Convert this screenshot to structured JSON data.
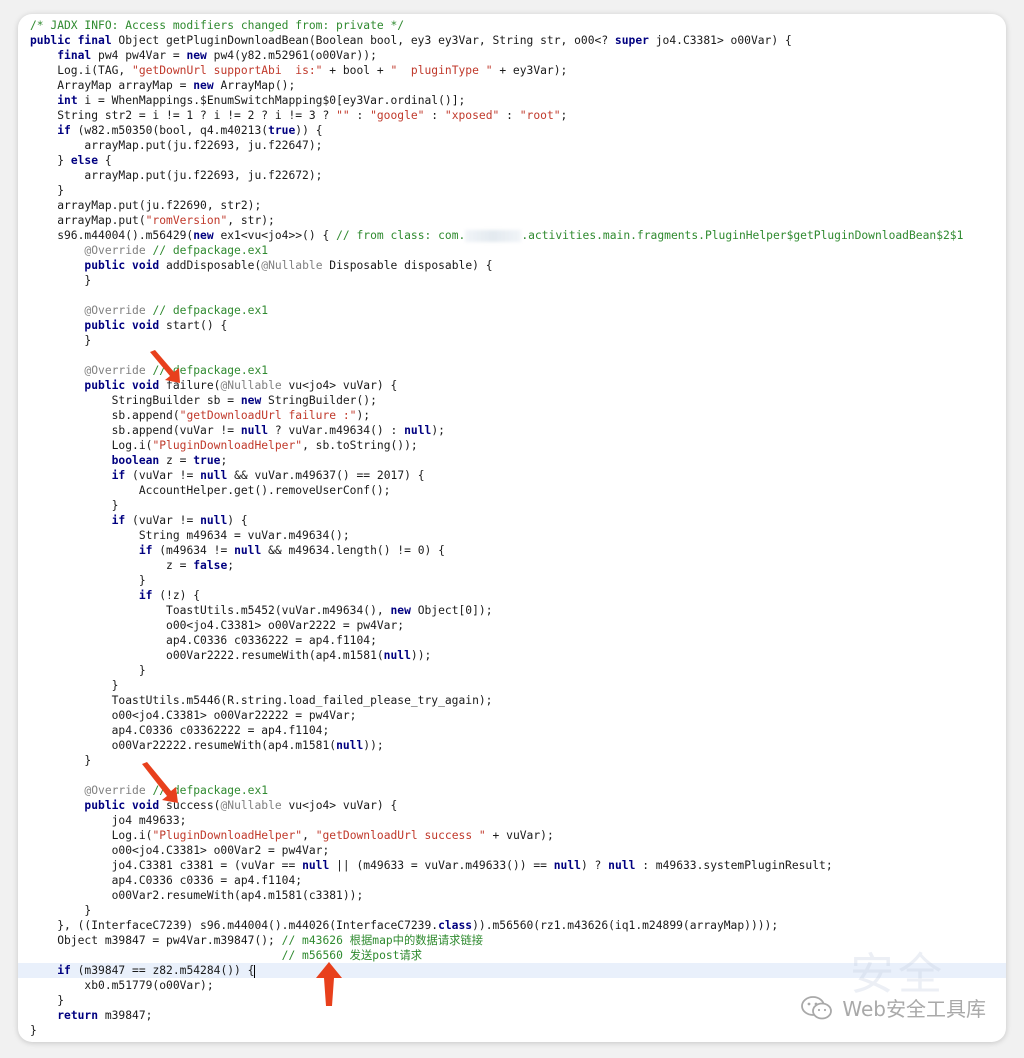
{
  "code_viewer": {
    "lines": [
      {
        "segs": [
          [
            "cm",
            "/* JADX INFO: Access modifiers changed from: private */"
          ]
        ]
      },
      {
        "segs": [
          [
            "kw",
            "public final "
          ],
          [
            "p",
            "Object getPluginDownloadBean(Boolean bool, ey3 ey3Var, String str, o00<? "
          ],
          [
            "kw",
            "super"
          ],
          [
            "p",
            " jo4.C3381> o00Var) {"
          ]
        ]
      },
      {
        "segs": [
          [
            "p",
            "    "
          ],
          [
            "kw",
            "final"
          ],
          [
            "p",
            " pw4 pw4Var = "
          ],
          [
            "kw",
            "new"
          ],
          [
            "p",
            " pw4(y82.m52961(o00Var));"
          ]
        ]
      },
      {
        "segs": [
          [
            "p",
            "    Log.i(TAG, "
          ],
          [
            "str",
            "\"getDownUrl supportAbi  is:\""
          ],
          [
            "p",
            " + bool + "
          ],
          [
            "str",
            "\"  pluginType \""
          ],
          [
            "p",
            " + ey3Var);"
          ]
        ]
      },
      {
        "segs": [
          [
            "p",
            "    ArrayMap arrayMap = "
          ],
          [
            "kw",
            "new"
          ],
          [
            "p",
            " ArrayMap();"
          ]
        ]
      },
      {
        "segs": [
          [
            "p",
            "    "
          ],
          [
            "kw",
            "int"
          ],
          [
            "p",
            " i = WhenMappings.$EnumSwitchMapping$0[ey3Var.ordinal()];"
          ]
        ]
      },
      {
        "segs": [
          [
            "p",
            "    String str2 = i != 1 ? i != 2 ? i != 3 ? "
          ],
          [
            "str",
            "\"\""
          ],
          [
            "p",
            " : "
          ],
          [
            "str",
            "\"google\""
          ],
          [
            "p",
            " : "
          ],
          [
            "str",
            "\"xposed\""
          ],
          [
            "p",
            " : "
          ],
          [
            "str",
            "\"root\""
          ],
          [
            "p",
            ";"
          ]
        ]
      },
      {
        "segs": [
          [
            "p",
            "    "
          ],
          [
            "kw",
            "if"
          ],
          [
            "p",
            " (w82.m50350(bool, q4.m40213("
          ],
          [
            "kw",
            "true"
          ],
          [
            "p",
            ")) {"
          ]
        ]
      },
      {
        "segs": [
          [
            "p",
            "        arrayMap.put(ju.f22693, ju.f22647);"
          ]
        ]
      },
      {
        "segs": [
          [
            "p",
            "    } "
          ],
          [
            "kw",
            "else"
          ],
          [
            "p",
            " {"
          ]
        ]
      },
      {
        "segs": [
          [
            "p",
            "        arrayMap.put(ju.f22693, ju.f22672);"
          ]
        ]
      },
      {
        "segs": [
          [
            "p",
            "    }"
          ]
        ]
      },
      {
        "segs": [
          [
            "p",
            "    arrayMap.put(ju.f22690, str2);"
          ]
        ]
      },
      {
        "segs": [
          [
            "p",
            "    arrayMap.put("
          ],
          [
            "str",
            "\"romVersion\""
          ],
          [
            "p",
            ", str);"
          ]
        ]
      },
      {
        "segs": [
          [
            "p",
            "    s96.m44004().m56429("
          ],
          [
            "kw",
            "new"
          ],
          [
            "p",
            " ex1<vu<jo4>>() { "
          ],
          [
            "cm",
            "// from class: com."
          ],
          [
            "blur",
            ""
          ],
          [
            "cm",
            ".activities.main.fragments.PluginHelper$getPluginDownloadBean$2$1"
          ]
        ]
      },
      {
        "segs": [
          [
            "p",
            "        "
          ],
          [
            "ann",
            "@Override"
          ],
          [
            "cm",
            " // defpackage.ex1"
          ]
        ]
      },
      {
        "segs": [
          [
            "p",
            "        "
          ],
          [
            "kw",
            "public void"
          ],
          [
            "p",
            " addDisposable("
          ],
          [
            "ann",
            "@Nullable"
          ],
          [
            "p",
            " Disposable disposable) {"
          ]
        ]
      },
      {
        "segs": [
          [
            "p",
            "        }"
          ]
        ]
      },
      {
        "segs": [
          [
            "p",
            ""
          ]
        ]
      },
      {
        "segs": [
          [
            "p",
            "        "
          ],
          [
            "ann",
            "@Override"
          ],
          [
            "cm",
            " // defpackage.ex1"
          ]
        ]
      },
      {
        "segs": [
          [
            "p",
            "        "
          ],
          [
            "kw",
            "public void"
          ],
          [
            "p",
            " start() {"
          ]
        ]
      },
      {
        "segs": [
          [
            "p",
            "        }"
          ]
        ]
      },
      {
        "segs": [
          [
            "p",
            ""
          ]
        ]
      },
      {
        "segs": [
          [
            "p",
            "        "
          ],
          [
            "ann",
            "@Override"
          ],
          [
            "cm",
            " // defpackage.ex1"
          ]
        ]
      },
      {
        "segs": [
          [
            "p",
            "        "
          ],
          [
            "kw",
            "public void"
          ],
          [
            "p",
            " failure("
          ],
          [
            "ann",
            "@Nullable"
          ],
          [
            "p",
            " vu<jo4> vuVar) {"
          ]
        ]
      },
      {
        "segs": [
          [
            "p",
            "            StringBuilder sb = "
          ],
          [
            "kw",
            "new"
          ],
          [
            "p",
            " StringBuilder();"
          ]
        ]
      },
      {
        "segs": [
          [
            "p",
            "            sb.append("
          ],
          [
            "str",
            "\"getDownloadUrl failure :\""
          ],
          [
            "p",
            ");"
          ]
        ]
      },
      {
        "segs": [
          [
            "p",
            "            sb.append(vuVar != "
          ],
          [
            "kw",
            "null"
          ],
          [
            "p",
            " ? vuVar.m49634() : "
          ],
          [
            "kw",
            "null"
          ],
          [
            "p",
            ");"
          ]
        ]
      },
      {
        "segs": [
          [
            "p",
            "            Log.i("
          ],
          [
            "str",
            "\"PluginDownloadHelper\""
          ],
          [
            "p",
            ", sb.toString());"
          ]
        ]
      },
      {
        "segs": [
          [
            "p",
            "            "
          ],
          [
            "kw",
            "boolean"
          ],
          [
            "p",
            " z = "
          ],
          [
            "kw",
            "true"
          ],
          [
            "p",
            ";"
          ]
        ]
      },
      {
        "segs": [
          [
            "p",
            "            "
          ],
          [
            "kw",
            "if"
          ],
          [
            "p",
            " (vuVar != "
          ],
          [
            "kw",
            "null"
          ],
          [
            "p",
            " && vuVar.m49637() == 2017) {"
          ]
        ]
      },
      {
        "segs": [
          [
            "p",
            "                AccountHelper.get().removeUserConf();"
          ]
        ]
      },
      {
        "segs": [
          [
            "p",
            "            }"
          ]
        ]
      },
      {
        "segs": [
          [
            "p",
            "            "
          ],
          [
            "kw",
            "if"
          ],
          [
            "p",
            " (vuVar != "
          ],
          [
            "kw",
            "null"
          ],
          [
            "p",
            ") {"
          ]
        ]
      },
      {
        "segs": [
          [
            "p",
            "                String m49634 = vuVar.m49634();"
          ]
        ]
      },
      {
        "segs": [
          [
            "p",
            "                "
          ],
          [
            "kw",
            "if"
          ],
          [
            "p",
            " (m49634 != "
          ],
          [
            "kw",
            "null"
          ],
          [
            "p",
            " && m49634.length() != 0) {"
          ]
        ]
      },
      {
        "segs": [
          [
            "p",
            "                    z = "
          ],
          [
            "kw",
            "false"
          ],
          [
            "p",
            ";"
          ]
        ]
      },
      {
        "segs": [
          [
            "p",
            "                }"
          ]
        ]
      },
      {
        "segs": [
          [
            "p",
            "                "
          ],
          [
            "kw",
            "if"
          ],
          [
            "p",
            " (!z) {"
          ]
        ]
      },
      {
        "segs": [
          [
            "p",
            "                    ToastUtils.m5452(vuVar.m49634(), "
          ],
          [
            "kw",
            "new"
          ],
          [
            "p",
            " Object[0]);"
          ]
        ]
      },
      {
        "segs": [
          [
            "p",
            "                    o00<jo4.C3381> o00Var2222 = pw4Var;"
          ]
        ]
      },
      {
        "segs": [
          [
            "p",
            "                    ap4.C0336 c0336222 = ap4.f1104;"
          ]
        ]
      },
      {
        "segs": [
          [
            "p",
            "                    o00Var2222.resumeWith(ap4.m1581("
          ],
          [
            "kw",
            "null"
          ],
          [
            "p",
            "));"
          ]
        ]
      },
      {
        "segs": [
          [
            "p",
            "                }"
          ]
        ]
      },
      {
        "segs": [
          [
            "p",
            "            }"
          ]
        ]
      },
      {
        "segs": [
          [
            "p",
            "            ToastUtils.m5446(R.string.load_failed_please_try_again);"
          ]
        ]
      },
      {
        "segs": [
          [
            "p",
            "            o00<jo4.C3381> o00Var22222 = pw4Var;"
          ]
        ]
      },
      {
        "segs": [
          [
            "p",
            "            ap4.C0336 c03362222 = ap4.f1104;"
          ]
        ]
      },
      {
        "segs": [
          [
            "p",
            "            o00Var22222.resumeWith(ap4.m1581("
          ],
          [
            "kw",
            "null"
          ],
          [
            "p",
            "));"
          ]
        ]
      },
      {
        "segs": [
          [
            "p",
            "        }"
          ]
        ]
      },
      {
        "segs": [
          [
            "p",
            ""
          ]
        ]
      },
      {
        "segs": [
          [
            "p",
            "        "
          ],
          [
            "ann",
            "@Override"
          ],
          [
            "cm",
            " // defpackage.ex1"
          ]
        ]
      },
      {
        "segs": [
          [
            "p",
            "        "
          ],
          [
            "kw",
            "public void"
          ],
          [
            "p",
            " success("
          ],
          [
            "ann",
            "@Nullable"
          ],
          [
            "p",
            " vu<jo4> vuVar) {"
          ]
        ]
      },
      {
        "segs": [
          [
            "p",
            "            jo4 m49633;"
          ]
        ]
      },
      {
        "segs": [
          [
            "p",
            "            Log.i("
          ],
          [
            "str",
            "\"PluginDownloadHelper\""
          ],
          [
            "p",
            ", "
          ],
          [
            "str",
            "\"getDownloadUrl success \""
          ],
          [
            "p",
            " + vuVar);"
          ]
        ]
      },
      {
        "segs": [
          [
            "p",
            "            o00<jo4.C3381> o00Var2 = pw4Var;"
          ]
        ]
      },
      {
        "segs": [
          [
            "p",
            "            jo4.C3381 c3381 = (vuVar == "
          ],
          [
            "kw",
            "null"
          ],
          [
            "p",
            " || (m49633 = vuVar.m49633()) == "
          ],
          [
            "kw",
            "null"
          ],
          [
            "p",
            ") ? "
          ],
          [
            "kw",
            "null"
          ],
          [
            "p",
            " : m49633.systemPluginResult;"
          ]
        ]
      },
      {
        "segs": [
          [
            "p",
            "            ap4.C0336 c0336 = ap4.f1104;"
          ]
        ]
      },
      {
        "segs": [
          [
            "p",
            "            o00Var2.resumeWith(ap4.m1581(c3381));"
          ]
        ]
      },
      {
        "segs": [
          [
            "p",
            "        }"
          ]
        ]
      },
      {
        "segs": [
          [
            "p",
            "    }, ((InterfaceC7239) s96.m44004().m44026(InterfaceC7239."
          ],
          [
            "kw",
            "class"
          ],
          [
            "p",
            ")).m56560(rz1.m43626(iq1.m24899(arrayMap))));"
          ]
        ]
      },
      {
        "segs": [
          [
            "p",
            "    Object m39847 = pw4Var.m39847(); "
          ],
          [
            "cm",
            "// m43626 根据map中的数据请求链接"
          ]
        ]
      },
      {
        "segs": [
          [
            "p",
            "                                     "
          ],
          [
            "cm",
            "// m56560 发送post请求"
          ]
        ]
      },
      {
        "segs": [
          [
            "p",
            "    "
          ],
          [
            "kw",
            "if"
          ],
          [
            "p",
            " (m39847 == z82.m54284()) {"
          ],
          [
            "cursor",
            ""
          ]
        ],
        "highlight": true
      },
      {
        "segs": [
          [
            "p",
            "        xb0.m51779(o00Var);"
          ]
        ]
      },
      {
        "segs": [
          [
            "p",
            "    }"
          ]
        ]
      },
      {
        "segs": [
          [
            "p",
            "    "
          ],
          [
            "kw",
            "return"
          ],
          [
            "p",
            " m39847;"
          ]
        ]
      },
      {
        "segs": [
          [
            "p",
            "}"
          ]
        ]
      }
    ]
  },
  "watermark": {
    "text": "Web安全工具库",
    "icon": "wechat-icon",
    "color": "#a9a9a9"
  },
  "colors": {
    "keyword": "#000080",
    "string": "#c0392b",
    "comment": "#2f8a2f",
    "annotation": "#808080",
    "arrow": "#e8401c",
    "highlight_line": "#e9f0fb"
  }
}
